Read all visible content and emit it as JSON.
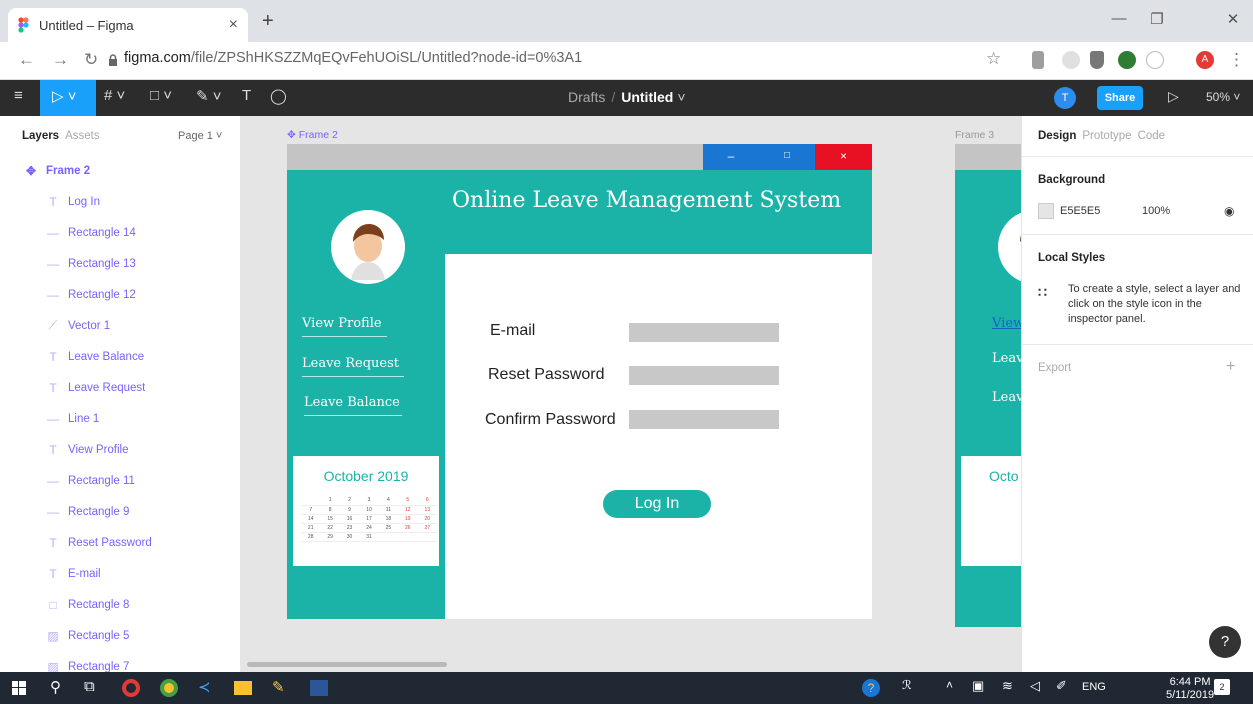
{
  "browser": {
    "tab_title": "Untitled – Figma",
    "tab_close": "×",
    "new_tab": "+",
    "url_domain": "figma.com",
    "url_path": "/file/ZPShHKSZZMqEQvFehUOiSL/Untitled?node-id=0%3A1"
  },
  "toolbar": {
    "breadcrumb_parent": "Drafts",
    "breadcrumb_sep": "/",
    "file_name": "Untitled",
    "avatar_initial": "T",
    "share_label": "Share",
    "zoom": "50%"
  },
  "layers_panel": {
    "tab_layers": "Layers",
    "tab_assets": "Assets",
    "page": "Page 1",
    "frame": "Frame 2",
    "items": [
      {
        "label": "Log In",
        "icon": "text-icon"
      },
      {
        "label": "Rectangle 14",
        "icon": "line-icon"
      },
      {
        "label": "Rectangle 13",
        "icon": "line-icon"
      },
      {
        "label": "Rectangle 12",
        "icon": "line-icon"
      },
      {
        "label": "Vector 1",
        "icon": "vector-icon"
      },
      {
        "label": "Leave Balance",
        "icon": "text-icon"
      },
      {
        "label": "Leave Request",
        "icon": "text-icon"
      },
      {
        "label": "Line 1",
        "icon": "line-icon"
      },
      {
        "label": "View Profile",
        "icon": "text-icon"
      },
      {
        "label": "Rectangle 11",
        "icon": "line-icon"
      },
      {
        "label": "Rectangle 9",
        "icon": "line-icon"
      },
      {
        "label": "Reset Password",
        "icon": "text-icon"
      },
      {
        "label": "E-mail",
        "icon": "text-icon"
      },
      {
        "label": "Rectangle 8",
        "icon": "rectangle-icon"
      },
      {
        "label": "Rectangle 5",
        "icon": "image-icon"
      },
      {
        "label": "Rectangle 7",
        "icon": "image-icon"
      }
    ]
  },
  "canvas": {
    "frame2_label": "Frame 2",
    "frame3_label": "Frame 3",
    "frame2": {
      "title": "Online Leave Management System",
      "nav": [
        "View Profile",
        "Leave Request",
        "Leave Balance"
      ],
      "fields": [
        "E-mail",
        "Reset Password",
        "Confirm Password"
      ],
      "button": "Log In",
      "calendar_title": "October 2019",
      "calendar_rows": [
        [
          "",
          "1",
          "2",
          "3",
          "4",
          "5",
          "6"
        ],
        [
          "7",
          "8",
          "9",
          "10",
          "11",
          "12",
          "13"
        ],
        [
          "14",
          "15",
          "16",
          "17",
          "18",
          "19",
          "20"
        ],
        [
          "21",
          "22",
          "23",
          "24",
          "25",
          "26",
          "27"
        ],
        [
          "28",
          "29",
          "30",
          "31",
          "",
          "",
          ""
        ]
      ],
      "window_min": "–",
      "window_max": "□",
      "window_close": "×"
    },
    "frame3": {
      "nav": [
        "View",
        "Leav",
        "Leav"
      ],
      "calendar_title": "Octo"
    }
  },
  "design_panel": {
    "tab_design": "Design",
    "tab_prototype": "Prototype",
    "tab_code": "Code",
    "background_heading": "Background",
    "background_hex": "E5E5E5",
    "background_opacity": "100%",
    "local_styles_heading": "Local Styles",
    "local_styles_msg": "To create a style, select a layer and click on the style icon in the inspector panel.",
    "export_label": "Export",
    "export_add": "+",
    "help": "?"
  },
  "taskbar": {
    "language": "ENG",
    "time": "6:44 PM",
    "date": "5/11/2019",
    "notifications": "2"
  },
  "colors": {
    "teal": "#1bb3a8",
    "figma_purple": "#7b61ff",
    "share_blue": "#18a0fb",
    "close_red": "#e81123",
    "canvas_bg": "#e5e5e5"
  }
}
